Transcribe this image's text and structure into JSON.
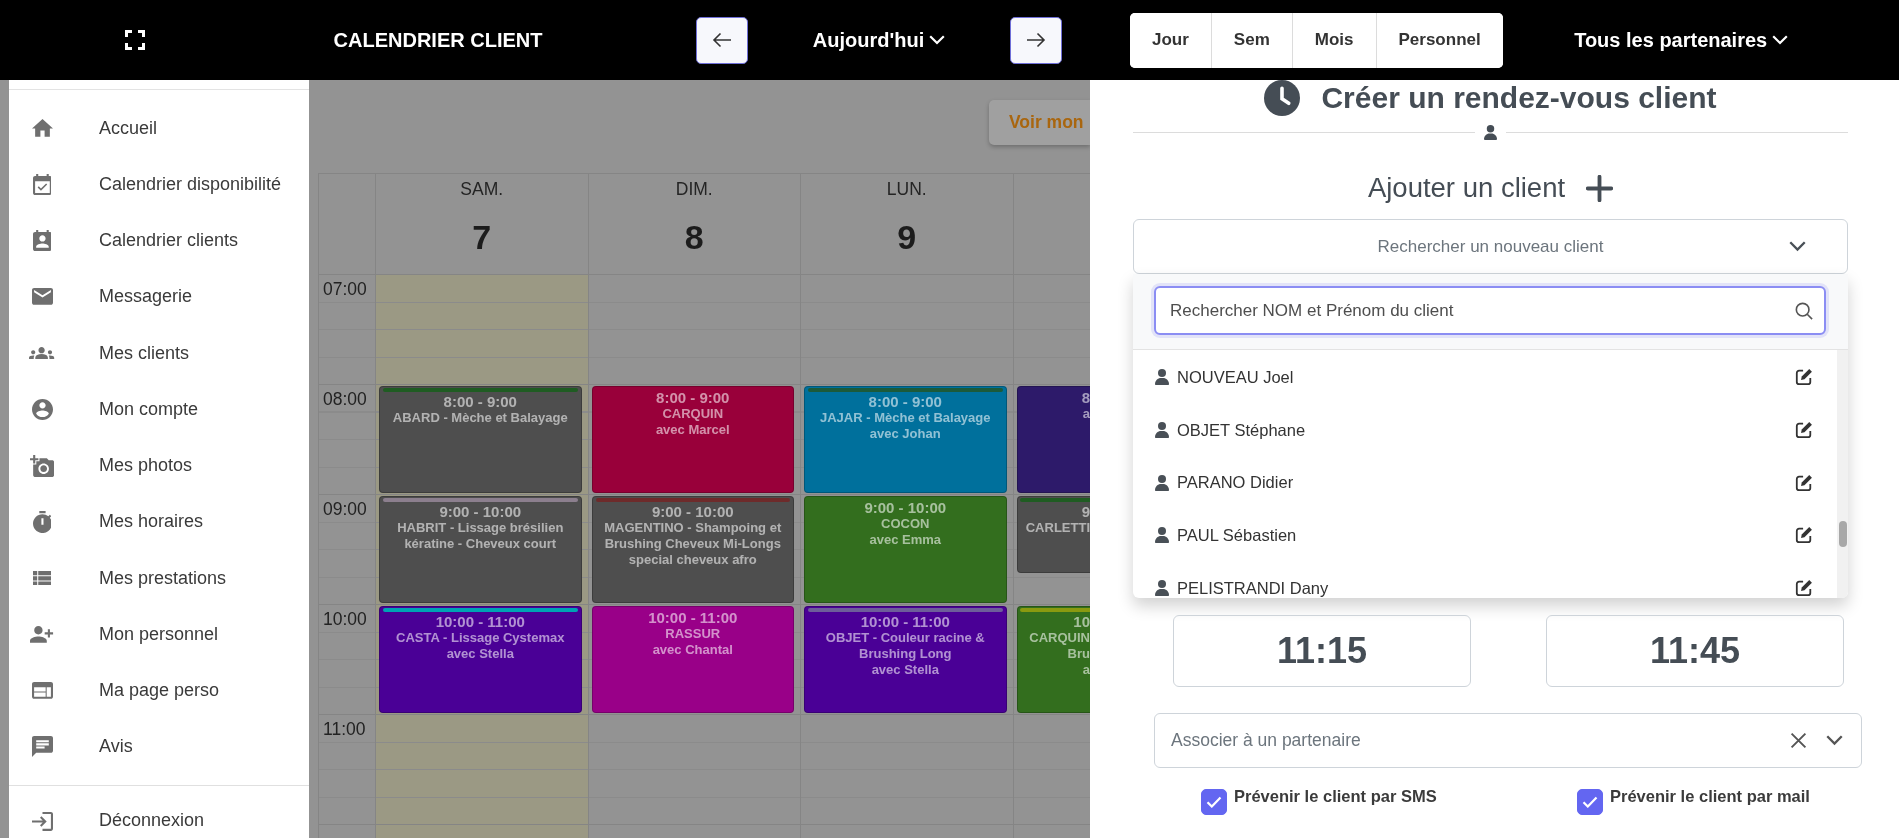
{
  "top_bar": {
    "title": "CALENDRIER CLIENT",
    "today_button": "Aujourd'hui",
    "views": [
      {
        "label": "Jour",
        "selected": false
      },
      {
        "label": "Sem",
        "selected": false
      },
      {
        "label": "Mois",
        "selected": false
      },
      {
        "label": "Personnel",
        "selected": false
      }
    ],
    "partner_filter": "Tous les partenaires"
  },
  "sidebar": {
    "items": [
      "Accueil",
      "Calendrier disponibilité",
      "Calendrier clients",
      "Messagerie",
      "Mes clients",
      "Mon compte",
      "Mes photos",
      "Mes horaires",
      "Mes prestations",
      "Mon personnel",
      "Ma page perso",
      "Avis"
    ],
    "logout": "Déconnexion"
  },
  "calendar": {
    "action_button": "Voir mon",
    "days": [
      {
        "name": "SAM.",
        "number": "7",
        "today": true
      },
      {
        "name": "DIM.",
        "number": "8",
        "today": false
      },
      {
        "name": "LUN.",
        "number": "9",
        "today": false
      },
      {
        "today": false
      }
    ],
    "hours": [
      {
        "label": "07:00"
      },
      {
        "label": "08:00",
        "events": [
          {
            "time": "8:00 - 9:00",
            "lines": [
              "ABARD - Mèche et Balayage"
            ],
            "color": "#4e4e4e",
            "tag": {
              "color": "#1f5c22"
            },
            "kind": "hour"
          },
          {
            "time": "8:00 - 9:00",
            "lines": [
              "CARQUIN",
              "avec Marcel"
            ],
            "color": "#99003a",
            "kind": "hour"
          },
          {
            "time": "8:00 - 9:00",
            "lines": [
              "JAJAR - Mèche et Balayage",
              "avec Johan"
            ],
            "color": "#00709c",
            "tag": {
              "color": "#1c5a3a"
            },
            "kind": "hour"
          },
          {
            "time": "8",
            "lines": [
              "a"
            ],
            "color": "#2d1a6a",
            "kind": "hour"
          }
        ]
      },
      {
        "label": "09:00",
        "events": [
          {
            "time": "9:00 - 10:00",
            "lines": [
              "HABRIT - Lissage brésilien kératine - Cheveux court"
            ],
            "color": "#4e4e4e",
            "tag": {
              "color": "#8c7f8e"
            },
            "kind": "hour"
          },
          {
            "time": "9:00 - 10:00",
            "lines": [
              "MAGENTINO - Shampoing et Brushing Cheveux Mi-Longs special cheveux afro"
            ],
            "color": "#4e4e4e",
            "tag": {
              "color": "#6e2b2b"
            },
            "kind": "hour"
          },
          {
            "time": "9:00 - 10:00",
            "lines": [
              "COCON",
              "avec Emma"
            ],
            "color": "#336e1e",
            "kind": "hour"
          },
          {
            "time": "9",
            "lines": [
              "CARLETTI"
            ],
            "color": "#4e4e4e",
            "tag": {
              "color": "#1f5c22"
            },
            "kind": "short"
          }
        ]
      },
      {
        "label": "10:00",
        "events": [
          {
            "time": "10:00 - 11:00",
            "lines": [
              "CASTA - Lissage Cystemax",
              "avec Stella"
            ],
            "color": "#4a0096",
            "tag": {
              "color": "#00a2b4"
            },
            "kind": "hour"
          },
          {
            "time": "10:00 - 11:00",
            "lines": [
              "RASSUR",
              "avec Chantal"
            ],
            "color": "#990088",
            "kind": "hour"
          },
          {
            "time": "10:00 - 11:00",
            "lines": [
              "OBJET - Couleur racine & Brushing Long",
              "avec Stella"
            ],
            "color": "#4a0096",
            "tag": {
              "color": "#6d5d9a"
            },
            "kind": "hour"
          },
          {
            "time": "10",
            "lines": [
              "CARQUIN",
              "Bru",
              "a"
            ],
            "color": "#336e1e",
            "tag": {
              "color": "#8a9a10"
            },
            "kind": "hour"
          }
        ]
      },
      {
        "label": "11:00"
      }
    ]
  },
  "appointment_panel": {
    "title": "Créer un rendez-vous client",
    "add_client": "Ajouter un client",
    "client_select": {
      "placeholder": "Rechercher un nouveau client",
      "expanded": true,
      "search": {
        "placeholder": "Rechercher NOM et Prénom du client"
      },
      "options": [
        "NOUVEAU Joel",
        "OBJET Stéphane",
        "PARANO Didier",
        "PAUL Sébastien",
        "PELISTRANDI Dany"
      ]
    },
    "start_time": "11:15",
    "end_time": "11:45",
    "partner_select": {
      "placeholder": "Associer à un partenaire"
    },
    "notifications": [
      {
        "label": "Prévenir le client par SMS",
        "checked": true
      },
      {
        "label": "Prévenir le client par mail",
        "checked": true
      }
    ]
  }
}
